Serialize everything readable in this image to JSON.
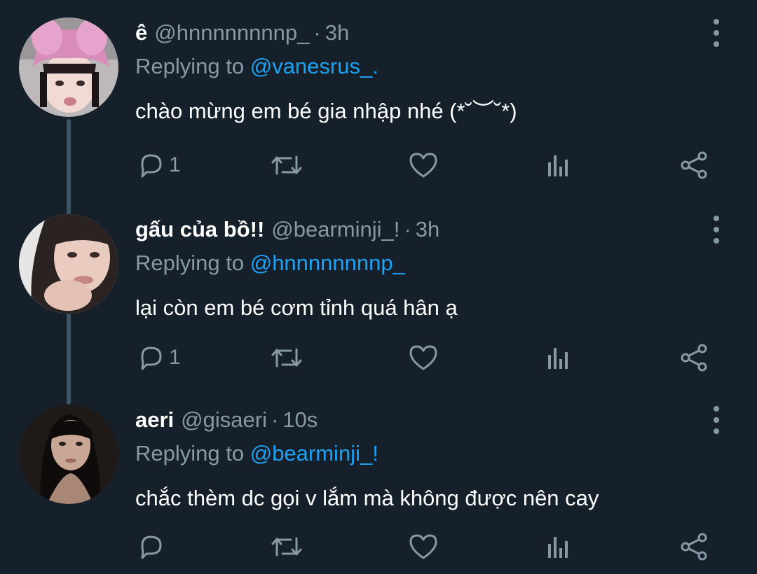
{
  "colors": {
    "background": "#15202b",
    "primary_text": "#ffffff",
    "secondary_text": "#8899a6",
    "accent": "#1da1f2",
    "thread_line": "#3d5466"
  },
  "tweets": [
    {
      "display_name": "ê",
      "handle": "@hnnnnnnnnp_",
      "separator": "·",
      "time": "3h",
      "replying_prefix": "Replying to ",
      "replying_to": "@vanesrus_.",
      "text": "chào mừng em bé gia nhập nhé (*˘︶˘*)",
      "reply_count": "1",
      "avatar_icon": "avatar-pink-bunny-hat"
    },
    {
      "display_name": "gấu của bồ!!",
      "handle": "@bearminji_!",
      "separator": "·",
      "time": "3h",
      "replying_prefix": "Replying to ",
      "replying_to": "@hnnnnnnnnp_",
      "text": "lại còn em bé cơm tỉnh quá hân ạ",
      "reply_count": "1",
      "avatar_icon": "avatar-girl-portrait"
    },
    {
      "display_name": "aeri",
      "handle": "@gisaeri",
      "separator": "·",
      "time": "10s",
      "replying_prefix": "Replying to ",
      "replying_to": "@bearminji_!",
      "text": "chắc thèm dc gọi v lắm mà không được nên cay",
      "reply_count": "",
      "avatar_icon": "avatar-dark-portrait"
    }
  ],
  "action_icons": [
    "reply-icon",
    "retweet-icon",
    "like-icon",
    "analytics-icon",
    "share-icon"
  ]
}
